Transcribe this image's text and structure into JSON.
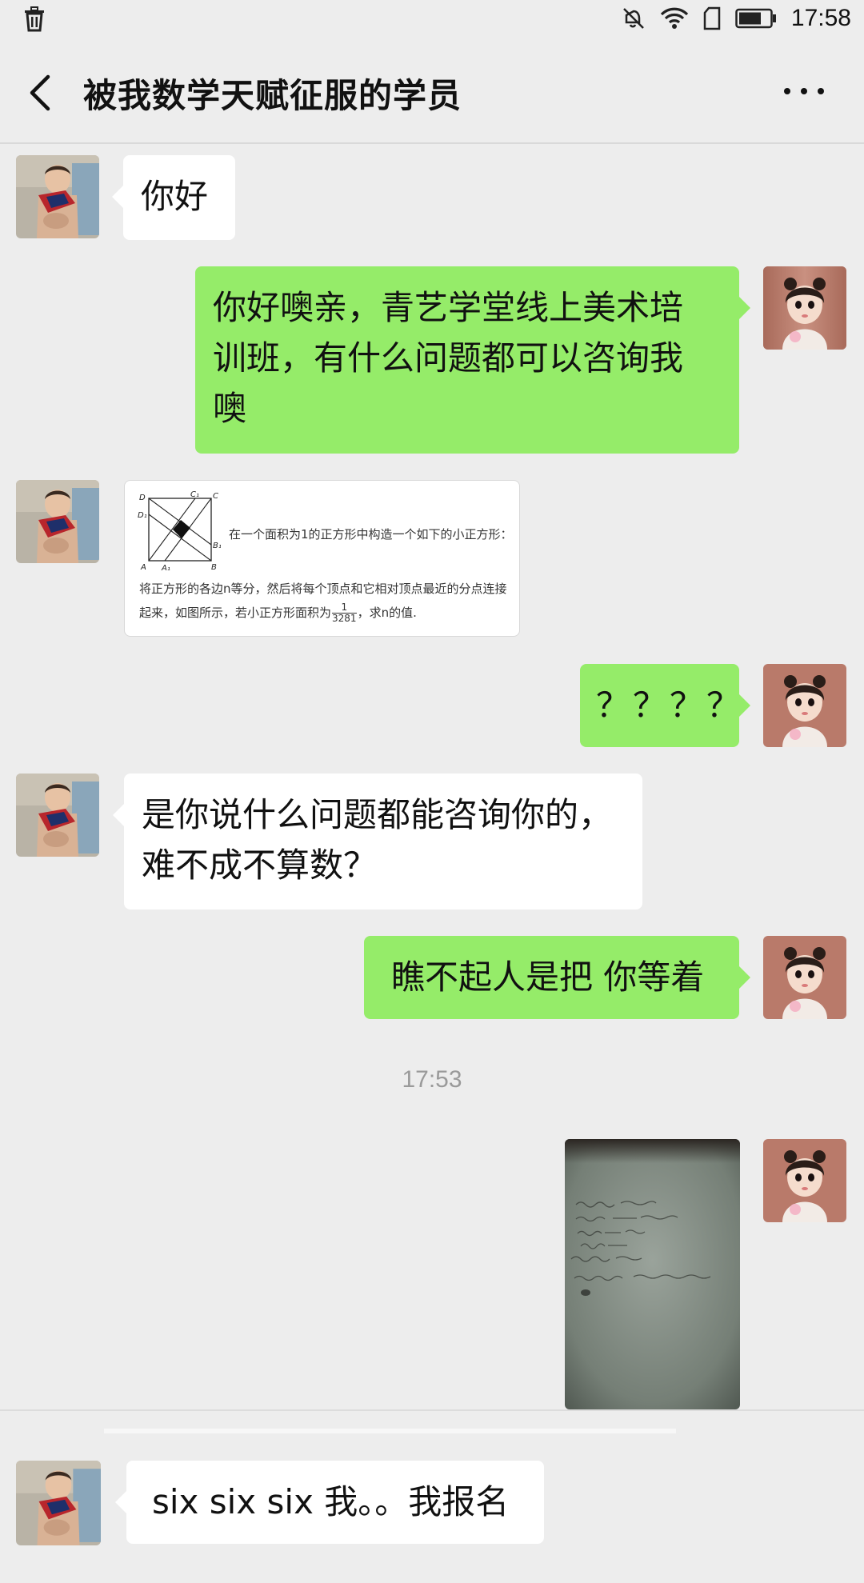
{
  "status_bar": {
    "time": "17:58",
    "icons": [
      "trash-icon",
      "mute-icon",
      "wifi-icon",
      "sim-icon",
      "battery-icon"
    ]
  },
  "header": {
    "title": "被我数学天赋征服的学员",
    "back_icon": "chevron-left-icon",
    "more_icon": "more-dots-icon"
  },
  "messages": [
    {
      "side": "left",
      "type": "text",
      "lines": [
        "你好"
      ]
    },
    {
      "side": "right",
      "type": "text",
      "lines": [
        "你好噢亲，青艺学堂线上美术培",
        "训班，有什么问题都可以咨询我",
        "噢"
      ]
    },
    {
      "side": "left",
      "type": "image",
      "problem": {
        "line1": "在一个面积为1的正方形中构造一个如下的小正方形：",
        "line2": "将正方形的各边n等分，然后将每个顶点和它相对顶点最近的分点连接",
        "line3a": "起来，如图所示，若小正方形面积为",
        "fraction_num": "1",
        "fraction_den": "3281",
        "line3b": "，求n的值.",
        "labels": {
          "D": "D",
          "C1": "C₁",
          "C": "C",
          "D1": "D₁",
          "B1": "B₁",
          "A": "A",
          "A1": "A₁",
          "B": "B"
        }
      }
    },
    {
      "side": "right",
      "type": "text",
      "lines": [
        "？？？？"
      ]
    },
    {
      "side": "left",
      "type": "text",
      "lines": [
        "是你说什么问题都能咨询你的，",
        "难不成不算数？"
      ]
    },
    {
      "side": "right",
      "type": "text",
      "lines": [
        "瞧不起人是把 你等着"
      ]
    },
    {
      "side": "right",
      "type": "photo",
      "description_icon": "handwritten-paper-photo"
    }
  ],
  "timestamp": "17:53",
  "bottom_reply": {
    "lines": [
      "six six six 我。。我报名"
    ]
  },
  "colors": {
    "background": "#ededed",
    "outgoing_bubble": "#95ec69",
    "incoming_bubble": "#ffffff"
  }
}
